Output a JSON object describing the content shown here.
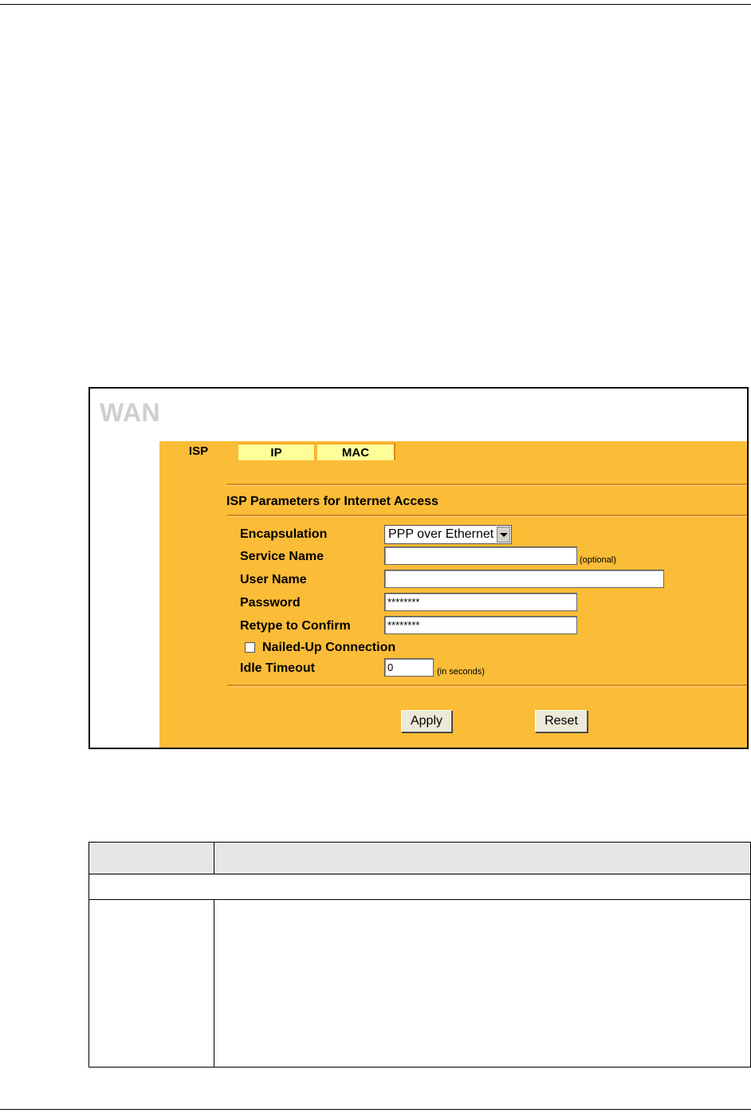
{
  "wan": {
    "title": "WAN",
    "tabs": [
      {
        "label": "ISP"
      },
      {
        "label": "IP"
      },
      {
        "label": "MAC"
      }
    ],
    "section_title": "ISP Parameters for Internet Access",
    "fields": {
      "encapsulation_label": "Encapsulation",
      "encapsulation_value": "PPP over Ethernet",
      "service_name_label": "Service Name",
      "service_name_value": "",
      "service_name_hint": "(optional)",
      "user_name_label": "User Name",
      "user_name_value": "",
      "password_label": "Password",
      "password_value": "********",
      "retype_label": "Retype to Confirm",
      "retype_value": "********",
      "nailed_up_label": "Nailed-Up Connection",
      "nailed_up_checked": false,
      "idle_timeout_label": "Idle Timeout",
      "idle_timeout_value": "0",
      "idle_timeout_hint": "(in seconds)"
    },
    "buttons": {
      "apply": "Apply",
      "reset": "Reset"
    }
  }
}
